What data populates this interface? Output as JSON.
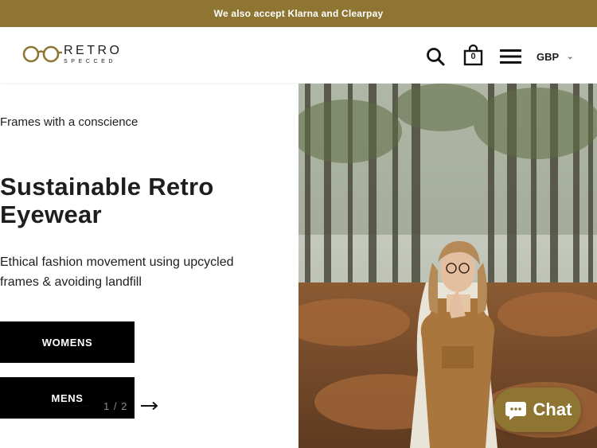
{
  "announcement": {
    "text": "We also accept Klarna and Clearpay"
  },
  "header": {
    "logo_top": "RETRO",
    "logo_bottom": "SPECCED",
    "cart_count": "0",
    "currency": "GBP",
    "icons": {
      "search": "search-icon",
      "cart": "bag-icon",
      "menu": "hamburger-icon",
      "chevron": "chevron-down-icon"
    }
  },
  "hero": {
    "eyebrow": "Frames with a conscience",
    "title": "Sustainable Retro Eyewear",
    "description": "Ethical fashion movement using upcycled frames & avoiding landfill",
    "buttons": [
      {
        "label": "WOMENS"
      },
      {
        "label": "MENS"
      }
    ],
    "slider": {
      "counter": "1 / 2"
    }
  },
  "chat": {
    "label": "Chat"
  },
  "colors": {
    "brand": "#8e7632",
    "text": "#1e1e1e",
    "button": "#000000"
  }
}
